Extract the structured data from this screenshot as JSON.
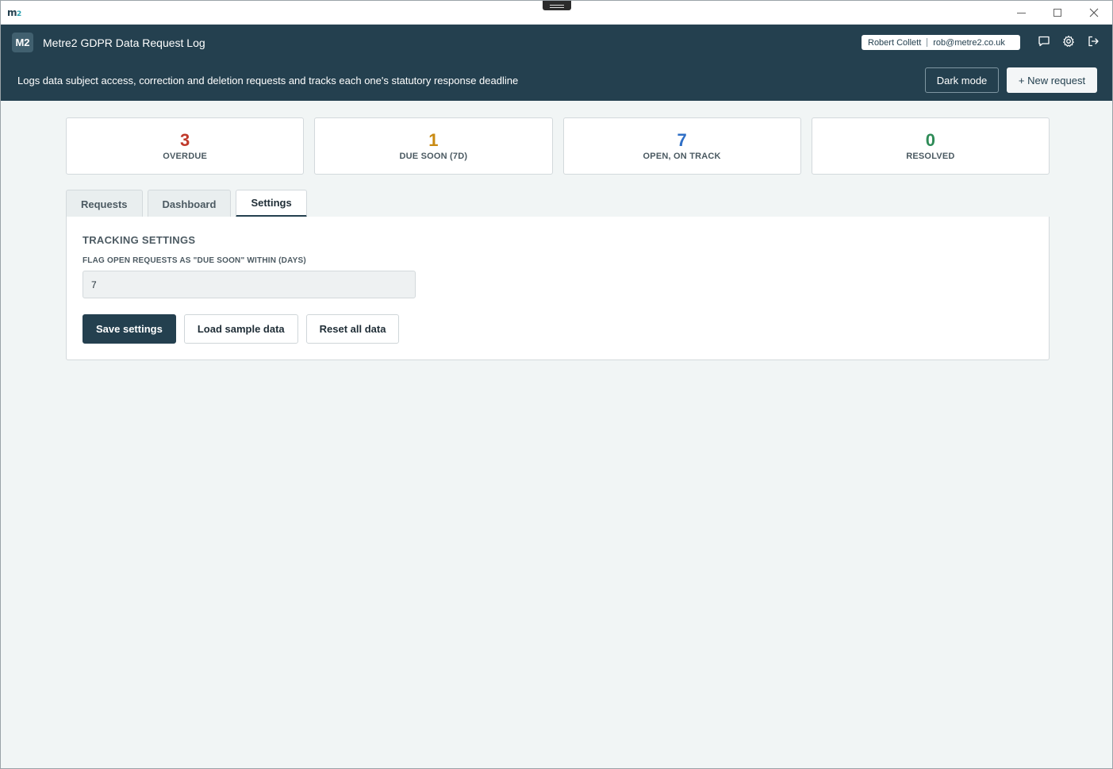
{
  "window": {
    "logo_main": "m",
    "logo_sub": "2"
  },
  "header": {
    "badge": "M2",
    "title": "Metre2 GDPR Data Request Log",
    "subtitle": "Logs data subject access, correction and deletion requests and tracks each one's statutory response deadline",
    "user_name": "Robert Collett",
    "user_email": "rob@metre2.co.uk",
    "icons": [
      "chat-icon",
      "gear-icon",
      "logout-icon"
    ],
    "dark_mode_label": "Dark mode",
    "new_request_label": "+ New request"
  },
  "stats": [
    {
      "value": "3",
      "label": "OVERDUE",
      "color": "#c0392b"
    },
    {
      "value": "1",
      "label": "DUE SOON (7D)",
      "color": "#c98a12"
    },
    {
      "value": "7",
      "label": "OPEN, ON TRACK",
      "color": "#2f6fc6"
    },
    {
      "value": "0",
      "label": "RESOLVED",
      "color": "#2e8b57"
    }
  ],
  "tabs": [
    {
      "label": "Requests",
      "active": false
    },
    {
      "label": "Dashboard",
      "active": false
    },
    {
      "label": "Settings",
      "active": true
    }
  ],
  "settings": {
    "heading": "TRACKING SETTINGS",
    "due_soon_label": "FLAG OPEN REQUESTS AS \"DUE SOON\" WITHIN (DAYS)",
    "due_soon_value": "7",
    "save_label": "Save settings",
    "load_sample_label": "Load sample data",
    "reset_label": "Reset all data"
  }
}
